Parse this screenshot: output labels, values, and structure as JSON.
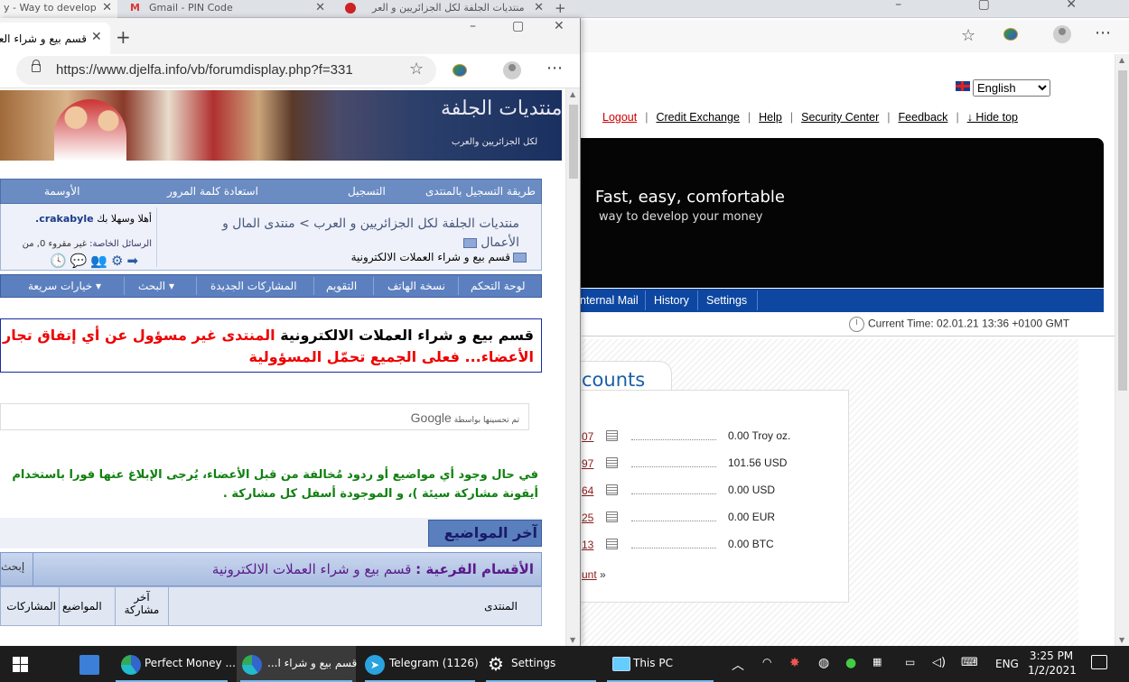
{
  "back_window": {
    "tabs": [
      {
        "label": "y - Way to develop",
        "close": "✕"
      },
      {
        "label": "Gmail - PIN Code",
        "close": "✕"
      },
      {
        "label": "منتديات الجلفة لكل الجزائريين و العر",
        "close": "✕"
      }
    ],
    "new_tab": "+",
    "window_controls": "–  ▢  ✕",
    "toolbar": {
      "star": "☆",
      "menu": "⋯"
    },
    "language": {
      "selected": "English",
      "options": [
        "English"
      ]
    },
    "top_links": [
      "Logout",
      "Credit Exchange",
      "Help",
      "Security Center",
      "Feedback",
      "↓ Hide top"
    ],
    "banner": {
      "line1": "Fast, easy, comfortable",
      "line2": "way to develop your money"
    },
    "nav": [
      "nternal Mail",
      "History",
      "Settings"
    ],
    "current_time": "Current Time: 02.01.21 13:36 +0100 GMT",
    "accounts_title": "counts",
    "accounts": [
      {
        "number": "07",
        "balance": "0.00 Troy oz."
      },
      {
        "number": "97",
        "balance": "101.56 USD"
      },
      {
        "number": "64",
        "balance": "0.00 USD"
      },
      {
        "number": "25",
        "balance": "0.00 EUR"
      },
      {
        "number": "13",
        "balance": "0.00 BTC"
      }
    ],
    "accounts_more": "unt",
    "accounts_more_suffix": " »"
  },
  "front_window": {
    "tab_title": "قسم بيع و شراء العم",
    "tab_close": "✕",
    "new_tab": "+",
    "window_controls": {
      "min": "–",
      "max": "▢",
      "close": "✕"
    },
    "url": "https://www.djelfa.info/vb/forumdisplay.php?f=331",
    "star": "☆",
    "menu": "⋯",
    "header": {
      "logo": "منتديات الجلفة",
      "logo_sub": "لكل الجزائريين والعرب"
    },
    "navbar1": [
      "طريقة التسجيل بالمنتدى",
      "التسجيل",
      "استعادة كلمة المرور",
      "الأوسمة"
    ],
    "welcome": {
      "greeting": "أهلا وسهلا بك",
      "user": "crakabyle.",
      "pm_label": "الرسائل الخاصة:",
      "pm_value": "غير مقروء 0, من"
    },
    "user_icons": "🕓💬👥⚙➡",
    "breadcrumb": "منتديات الجلفة لكل الجزائريين و العرب > منتدى المال و الأعمال",
    "current_forum": "قسم بيع و شراء العملات الالكترونية",
    "navbar2": [
      "لوحة التحكم",
      "نسخة الهاتف",
      "التقويم",
      "المشاركات الجديدة",
      "البحث ▾",
      "خيارات سريعة ▾"
    ],
    "notice": {
      "title_black": "قسم بيع و شراء العملات الالكترونية",
      "title_red": "المنتدى غير مسؤول عن أي إتفاق تجار",
      "line2": "الأعضاء... فعلى الجميع تحمّل المسؤولية"
    },
    "google": {
      "prefix": "تم تحسينها بواسطة",
      "brand": "Google"
    },
    "warning": "في حال وجود أي مواضيع أو ردود مُخالفة من قبل الأعضاء، يُرجى الإبلاغ عنها فورا باستخدام أيقونة مشاركة سيئة )، و الموجودة أسفل كل مشاركة .",
    "latest": "آخر المواضيع",
    "subforums_label": "الأقسام الفرعية :",
    "subforums_value": "قسم بيع و شراء العملات الالكترونية",
    "search_short": "إبحث",
    "table_headers": [
      "المنتدى",
      "آخر مشاركة",
      "المواضيع",
      "المشاركات"
    ]
  },
  "taskbar": {
    "items": [
      {
        "label": "Perfect Money ..."
      },
      {
        "label": "قسم بيع و شراء ا..."
      },
      {
        "label": "Telegram (1126)"
      },
      {
        "label": "Settings"
      },
      {
        "label": "This PC"
      }
    ],
    "language": "ENG",
    "time": "3:25 PM",
    "date": "1/2/2021"
  }
}
